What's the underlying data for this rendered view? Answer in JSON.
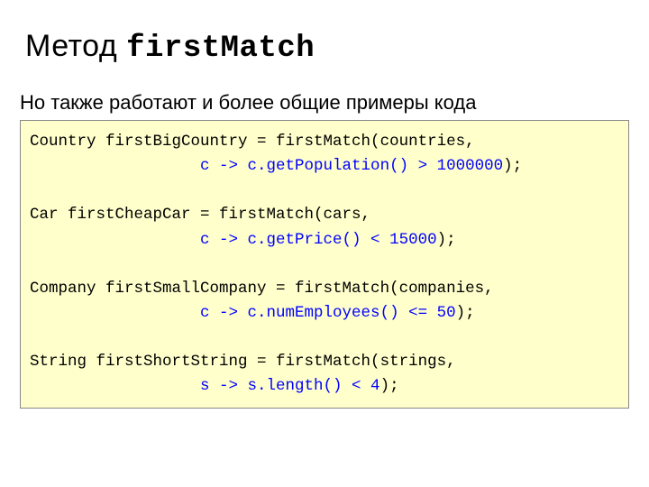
{
  "title_plain": "Метод ",
  "title_mono": "firstMatch",
  "subtitle": "Но также работают и более общие примеры кода",
  "code": {
    "l1a": "Country firstBigCountry = firstMatch(countries,",
    "l1b_indent": "                  ",
    "l1b_blue": "c -> c.getPopulation() > 1000000",
    "l1c": ");",
    "l2a": "Car firstCheapCar = firstMatch(cars,",
    "l2b_indent": "                  ",
    "l2b_blue": "c -> c.getPrice() < 15000",
    "l2c": ");",
    "l3a": "Company firstSmallCompany = firstMatch(companies,",
    "l3b_indent": "                  ",
    "l3b_blue": "c -> c.numEmployees() <= 50",
    "l3c": ");",
    "l4a": "String firstShortString = firstMatch(strings,",
    "l4b_indent": "                  ",
    "l4b_blue": "s -> s.length() < 4",
    "l4c": ");"
  }
}
